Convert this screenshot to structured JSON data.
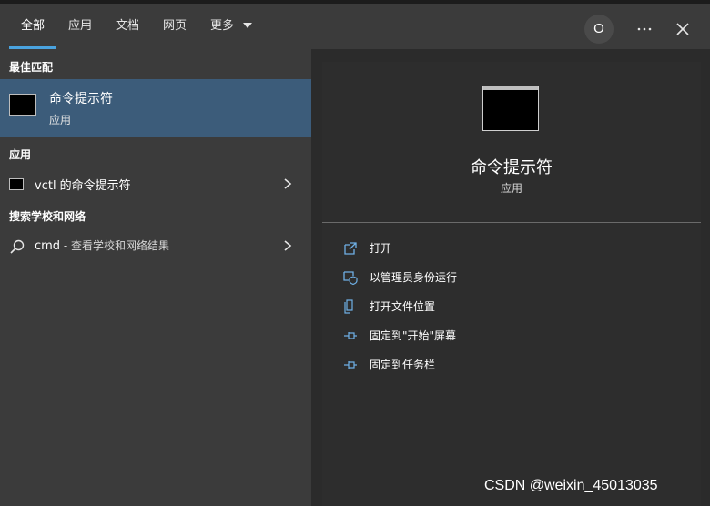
{
  "tabs": [
    {
      "label": "全部"
    },
    {
      "label": "应用"
    },
    {
      "label": "文档"
    },
    {
      "label": "网页"
    },
    {
      "label": "更多"
    }
  ],
  "header": {
    "avatar_letter": "O"
  },
  "sections": {
    "best_match": "最佳匹配",
    "apps": "应用",
    "search_school": "搜索学校和网络"
  },
  "best_match": {
    "title": "命令提示符",
    "subtitle": "应用"
  },
  "app_results": [
    {
      "label": "vctl 的命令提示符"
    }
  ],
  "search_result": {
    "query": "cmd",
    "suffix": " - 查看学校和网络结果"
  },
  "preview": {
    "title": "命令提示符",
    "subtitle": "应用",
    "actions": [
      {
        "label": "打开",
        "icon": "open-icon"
      },
      {
        "label": "以管理员身份运行",
        "icon": "shield-run-icon"
      },
      {
        "label": "打开文件位置",
        "icon": "file-location-icon"
      },
      {
        "label": "固定到\"开始\"屏幕",
        "icon": "pin-icon"
      },
      {
        "label": "固定到任务栏",
        "icon": "pin-icon"
      }
    ]
  },
  "watermark": "CSDN @weixin_45013035",
  "colors": {
    "accent": "#4aa3df",
    "selected_row": "#3c5c7a",
    "left_panel": "#3b3b3b",
    "right_panel": "#2d2d2d"
  }
}
